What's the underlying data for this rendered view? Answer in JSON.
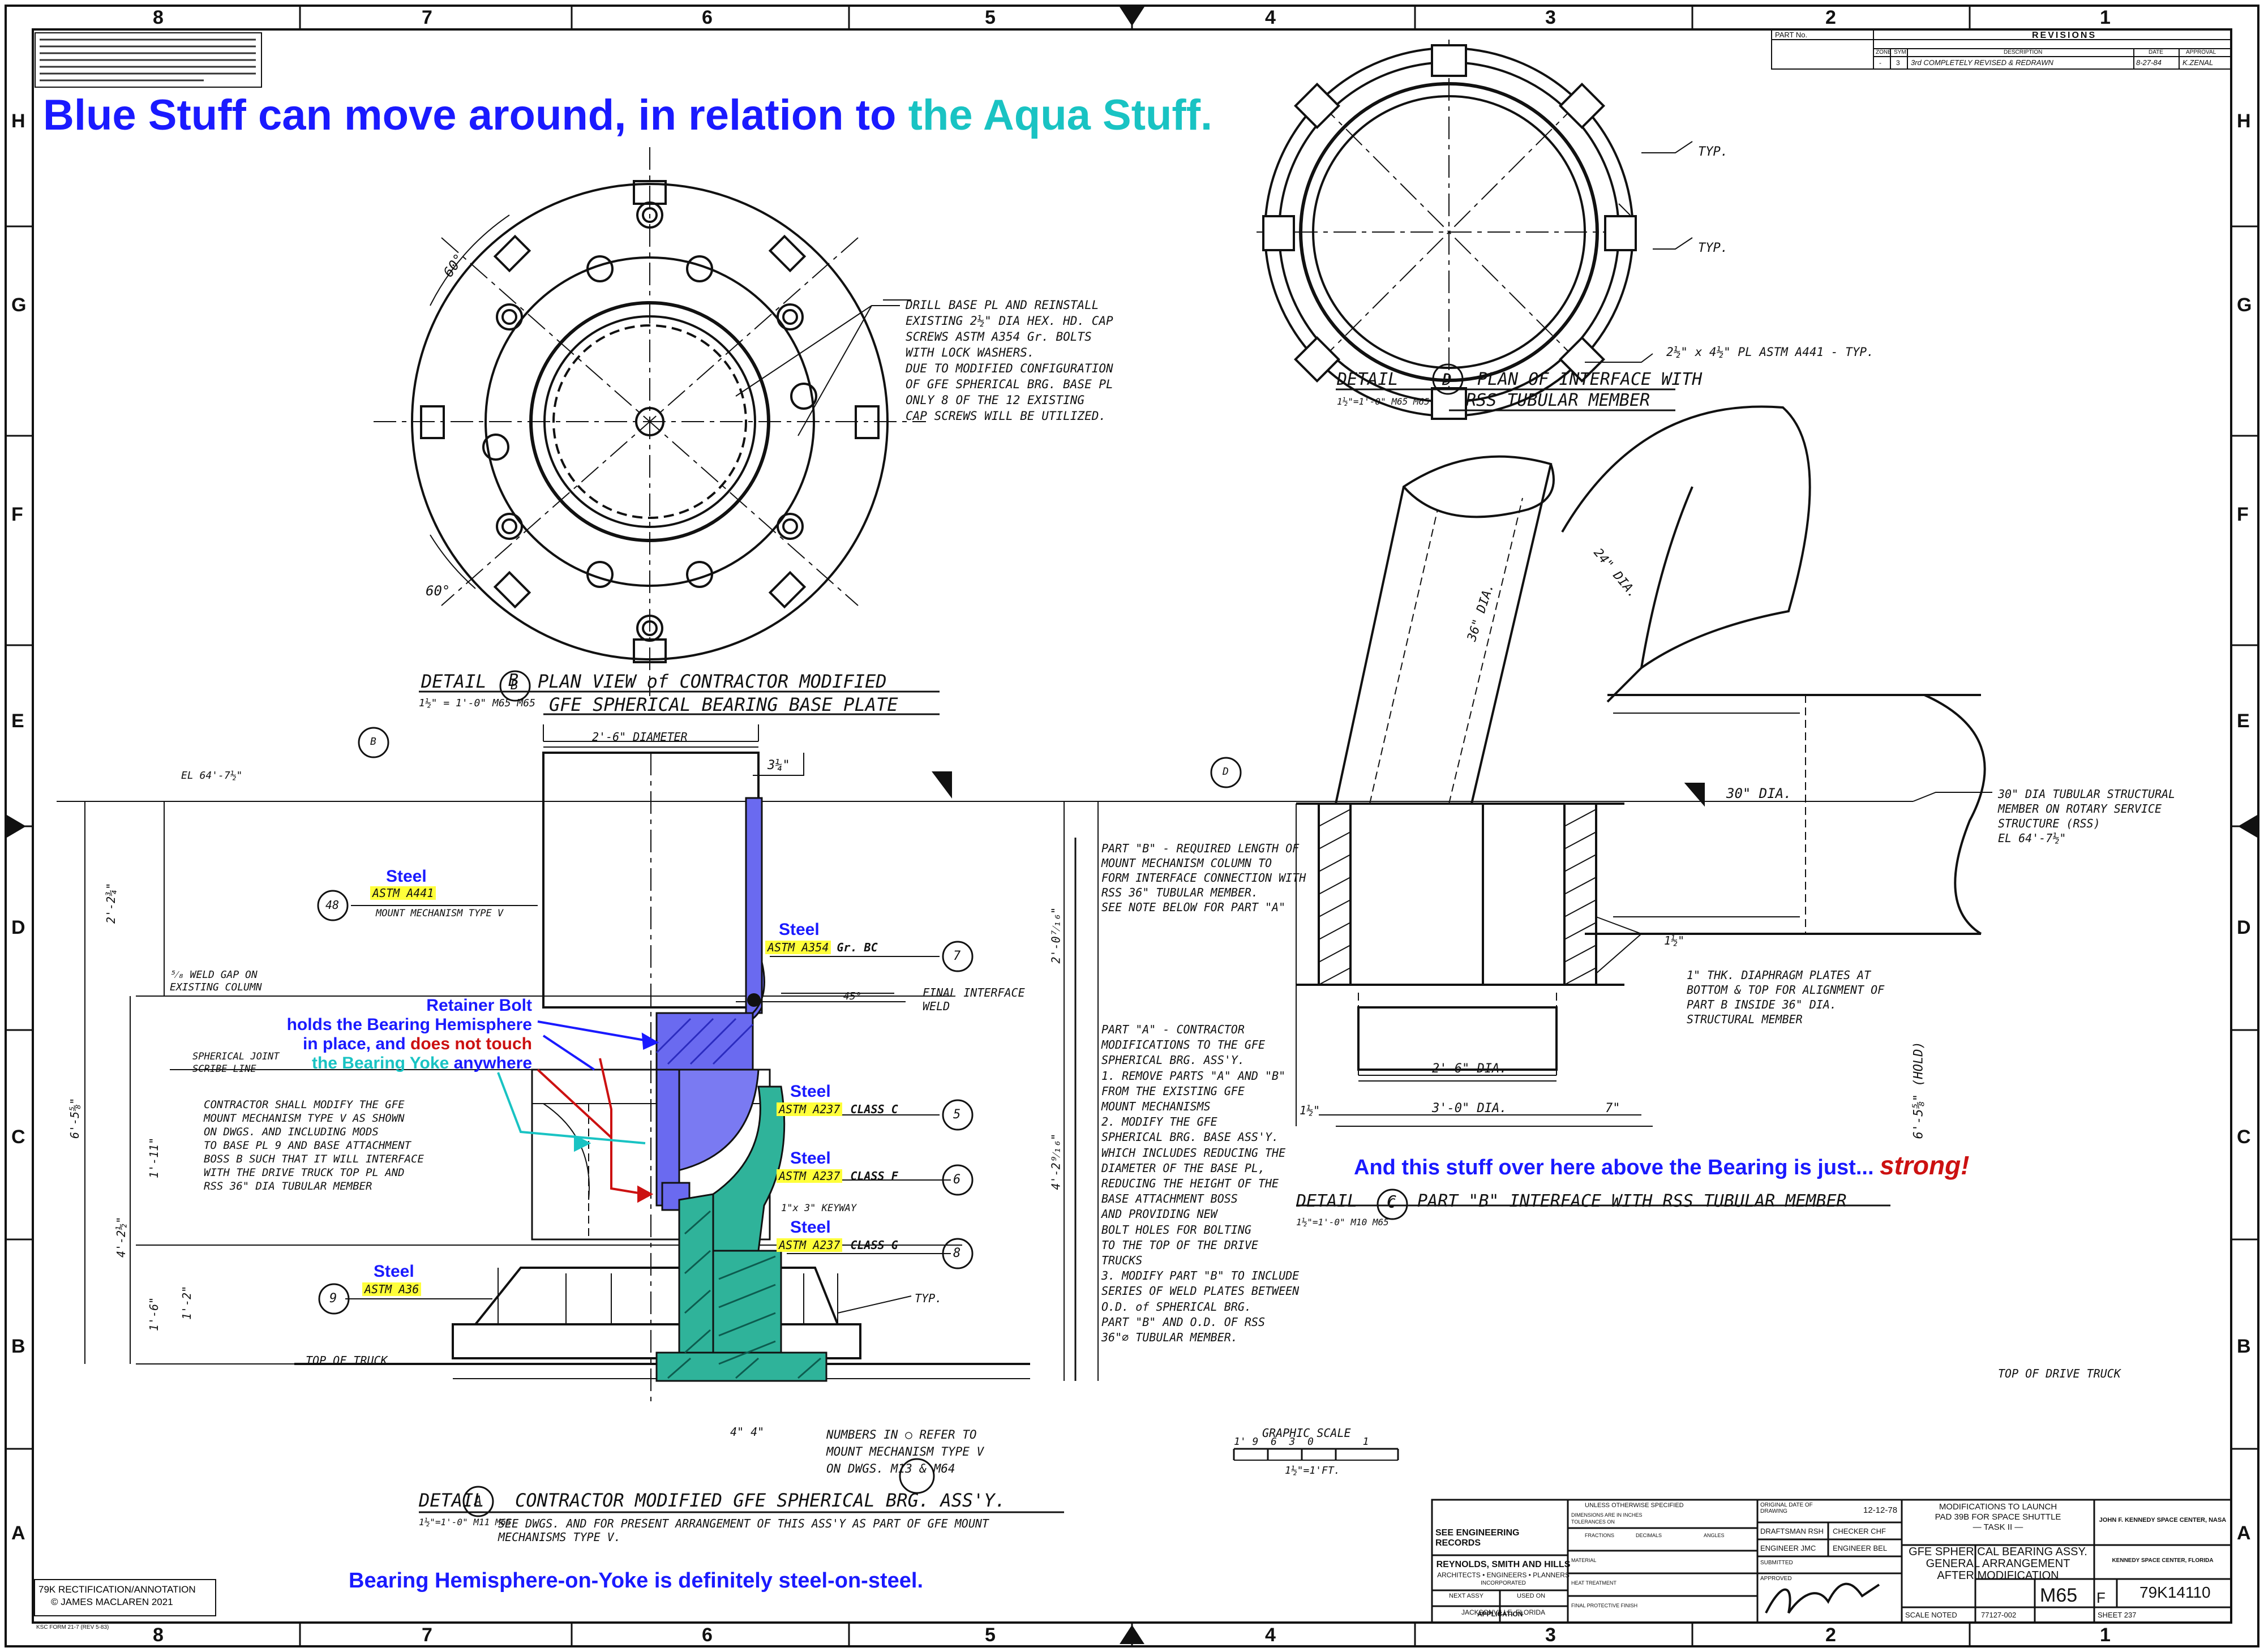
{
  "heading": {
    "part1": "Blue Stuff can move around, in relation to",
    "part2": "the Aqua Stuff."
  },
  "zones": {
    "cols": [
      "8",
      "7",
      "6",
      "5",
      "4",
      "3",
      "2",
      "1"
    ],
    "rows": [
      "H",
      "G",
      "F",
      "E",
      "D",
      "C",
      "B",
      "A"
    ]
  },
  "colors": {
    "blue": "#1a1aff",
    "aqua": "#19c3c3",
    "red": "#cc1111",
    "highlight": "#ffff3a",
    "part_blue": "#6a6af0",
    "part_teal": "#2fb39a"
  },
  "revisions": {
    "part_no": "PART No.",
    "title": "REVISIONS",
    "cols": [
      "ZONE",
      "SYM",
      "DESCRIPTION",
      "DATE",
      "APPROVAL"
    ],
    "row": [
      "-",
      "3",
      "3rd COMPLETELY REVISED & REDRAWN",
      "8-27-84",
      "K.ZENAL"
    ]
  },
  "details": {
    "b_label": "DETAIL",
    "b_letter": "B",
    "b_title1": "PLAN VIEW of CONTRACTOR MODIFIED",
    "b_title2": "GFE SPHERICAL BEARING BASE PLATE",
    "b_scale": "1½\" = 1'-0\" M65 M65",
    "d_label": "DETAIL",
    "d_letter": "D",
    "d_title1": "PLAN OF INTERFACE WITH",
    "d_title2": "RSS TUBULAR MEMBER",
    "d_scale": "1½\"=1'-0\" M65 M65",
    "c_label": "DETAIL",
    "c_letter": "C",
    "c_title": "PART \"B\" INTERFACE WITH RSS TUBULAR MEMBER",
    "c_scale": "1½\"=1'-0\" M10 M65",
    "a_label": "DETAIL",
    "a_letter": "A",
    "a_title1": "CONTRACTOR MODIFIED GFE SPHERICAL BRG. ASS'Y.",
    "a_title2": "SEE DWGS. AND FOR PRESENT ARRANGEMENT OF THIS ASS'Y AS PART OF GFE MOUNT MECHANISMS TYPE V.",
    "a_scale": "1½\"=1'-0\" M11 M65"
  },
  "notes": {
    "drill": [
      "DRILL BASE PL AND REINSTALL",
      "EXISTING 2½\" DIA HEX. HD. CAP",
      "SCREWS ASTM A354 Gr. BOLTS",
      "WITH LOCK WASHERS.",
      "DUE TO MODIFIED CONFIGURATION",
      "OF GFE SPHERICAL BRG. BASE PL",
      "ONLY 8 OF THE 12 EXISTING",
      "CAP SCREWS WILL BE UTILIZED."
    ],
    "part_b": [
      "PART \"B\" - REQUIRED LENGTH OF",
      "MOUNT MECHANISM COLUMN TO",
      "FORM INTERFACE CONNECTION WITH",
      "RSS 36\" TUBULAR MEMBER.",
      "SEE NOTE BELOW FOR PART \"A\""
    ],
    "part_a": [
      "PART \"A\" - CONTRACTOR",
      "MODIFICATIONS TO THE GFE",
      "SPHERICAL BRG. ASS'Y.",
      "1. REMOVE PARTS \"A\" AND \"B\"",
      "FROM THE EXISTING GFE",
      "MOUNT MECHANISMS",
      "2. MODIFY THE GFE",
      "SPHERICAL BRG. BASE ASS'Y.",
      "WHICH INCLUDES REDUCING THE",
      "DIAMETER OF THE BASE PL,",
      "REDUCING THE HEIGHT OF THE",
      "BASE ATTACHMENT BOSS",
      "AND PROVIDING NEW",
      "BOLT HOLES FOR BOLTING",
      "TO THE TOP OF THE DRIVE",
      "TRUCKS",
      "3. MODIFY PART \"B\" TO INCLUDE",
      "SERIES OF WELD PLATES BETWEEN",
      "O.D. of SPHERICAL BRG.",
      "PART \"B\" AND O.D. OF RSS",
      "36\"⌀ TUBULAR MEMBER."
    ],
    "contractor": [
      "CONTRACTOR SHALL MODIFY THE GFE",
      "MOUNT MECHANISM TYPE V AS SHOWN",
      "ON DWGS. AND INCLUDING MODS",
      "TO BASE PL 9 AND BASE ATTACHMENT",
      "BOSS B SUCH THAT IT WILL INTERFACE",
      "WITH THE DRIVE TRUCK TOP PL AND",
      "RSS 36\" DIA TUBULAR MEMBER"
    ],
    "tubular": [
      "30\" DIA TUBULAR STRUCTURAL",
      "MEMBER ON ROTARY SERVICE",
      "STRUCTURE (RSS)",
      "EL 64'-7½\""
    ],
    "diaphragm": [
      "1\" THK. DIAPHRAGM PLATES AT",
      "BOTTOM & TOP FOR ALIGNMENT OF",
      "PART B INSIDE 36\" DIA.",
      "STRUCTURAL MEMBER"
    ],
    "numbers": [
      "NUMBERS IN ○ REFER TO",
      "MOUNT MECHANISM TYPE V",
      "ON DWGS. M13 & M64"
    ],
    "weld_gap": [
      "⁵⁄₈ WELD GAP ON",
      "EXISTING COLUMN"
    ],
    "spherical_joint": [
      "SPHERICAL JOINT",
      "SCRIBE LINE"
    ],
    "final_interface": [
      "FINAL INTERFACE",
      "WELD"
    ],
    "keyway": "1\"x 3\" KEYWAY",
    "top_truck": "TOP OF TRUCK",
    "top_drive_truck": "TOP OF DRIVE TRUCK",
    "el": "EL 64'-7½\"",
    "astm_a441_plate": "2½\" x 4½\" PL ASTM A441 - TYP.",
    "typ": "TYP."
  },
  "dims": {
    "dia_2_6": "2'-6\" DIAMETER",
    "d_3_4": "3¼\"",
    "d_30": "30\" DIA.",
    "d_36": "36\" DIA.",
    "d_24": "24\" DIA.",
    "d_2_6": "2'-6\" DIA.",
    "d_3_0": "3'-0\" DIA.",
    "d_7": "7\"",
    "d_1_half": "1½\"",
    "d_4_4": "4\"  4\"",
    "v_1": "2'-2¾\"",
    "v_2": "2'-0⁷⁄₁₆\"",
    "v_3": "4'-2⁹⁄₁₆\"",
    "v_4": "6'-5⅝\"",
    "v_5": "4'-2½\"",
    "v_6": "1'-11\"",
    "v_7": "1'-6\"",
    "v_8": "1'-2\"",
    "hold": "6'-5⅝\" (HOLD)",
    "angle": "60°",
    "deg45": "45°"
  },
  "callouts": {
    "c48": "48",
    "c7": "7",
    "c5": "5",
    "c6": "6",
    "c8": "8",
    "c9": "9",
    "steel": "Steel",
    "a441": "ASTM A441",
    "a441_sub": "MOUNT MECHANISM TYPE V",
    "a354": "ASTM A354",
    "a354_sub": "Gr. BC",
    "a237c": "ASTM A237",
    "a237c_sub": "CLASS C",
    "a237f": "ASTM A237",
    "a237f_sub": "CLASS F",
    "a237g": "ASTM A237",
    "a237g_sub": "CLASS G",
    "a36": "ASTM A36"
  },
  "annotations": {
    "retainer1": "Retainer Bolt",
    "retainer2": "holds the Bearing Hemisphere",
    "retainer3a": "in place, and ",
    "retainer3b": "does not touch",
    "retainer4a": "the Bearing Yoke",
    "retainer4b": " anywhere",
    "strong_a": "And this stuff over here above the Bearing is just...",
    "strong_b": "strong!",
    "bottom": "Bearing Hemisphere-on-Yoke is definitely steel-on-steel.",
    "credit1": "79K RECTIFICATION/ANNOTATION",
    "credit2": "© JAMES MACLAREN 2021"
  },
  "scale": {
    "label": "GRAPHIC SCALE",
    "ticks": "1' 9  6  3  0        1",
    "unit": "1½\"=1'FT."
  },
  "titleblock": {
    "see_eng": "SEE ENGINEERING RECORDS",
    "firm1": "REYNOLDS, SMITH AND HILLS",
    "firm2": "ARCHITECTS • ENGINEERS • PLANNERS",
    "firm3": "INCORPORATED",
    "firm4": "JACKSONVILLE, FLORIDA",
    "next_assy": "NEXT ASSY",
    "used_on": "USED ON",
    "application": "APPLICATION",
    "unless": "UNLESS OTHERWISE SPECIFIED",
    "dims_inches": "DIMENSIONS ARE IN INCHES",
    "tolerances": "TOLERANCES ON",
    "fractions": "FRACTIONS",
    "decimals": "DECIMALS",
    "angles": "ANGLES",
    "material": "MATERIAL",
    "heat": "HEAT TREATMENT",
    "finish": "FINAL PROTECTIVE FINISH",
    "orig_date": "ORIGINAL DATE OF DRAWING",
    "date_val": "12-12-78",
    "drafted": "DRAFTSMAN RSH",
    "checked": "CHECKER CHF",
    "engineer": "ENGINEER JMC",
    "eng_chk": "ENGINEER BEL",
    "submitted": "SUBMITTED",
    "approved": "APPROVED",
    "mod_1": "MODIFICATIONS TO LAUNCH",
    "mod_2": "PAD 39B FOR SPACE SHUTTLE",
    "mod_3": "— TASK II —",
    "gfe_1": "GFE SPHERICAL BEARING ASSY.",
    "gfe_2": "GENERAL ARRANGEMENT",
    "gfe_3": "AFTER MODIFICATION",
    "ksc1": "JOHN F. KENNEDY SPACE CENTER, NASA",
    "ksc2": "KENNEDY SPACE CENTER, FLORIDA",
    "sheet_code": "M65",
    "dwg_size": "F",
    "dwg_no": "79K14110",
    "scale_lbl": "SCALE NOTED",
    "sheet_num": "SHEET 237",
    "ref": "77127-002",
    "form": "KSC FORM 21-7 (REV 5-83)"
  }
}
